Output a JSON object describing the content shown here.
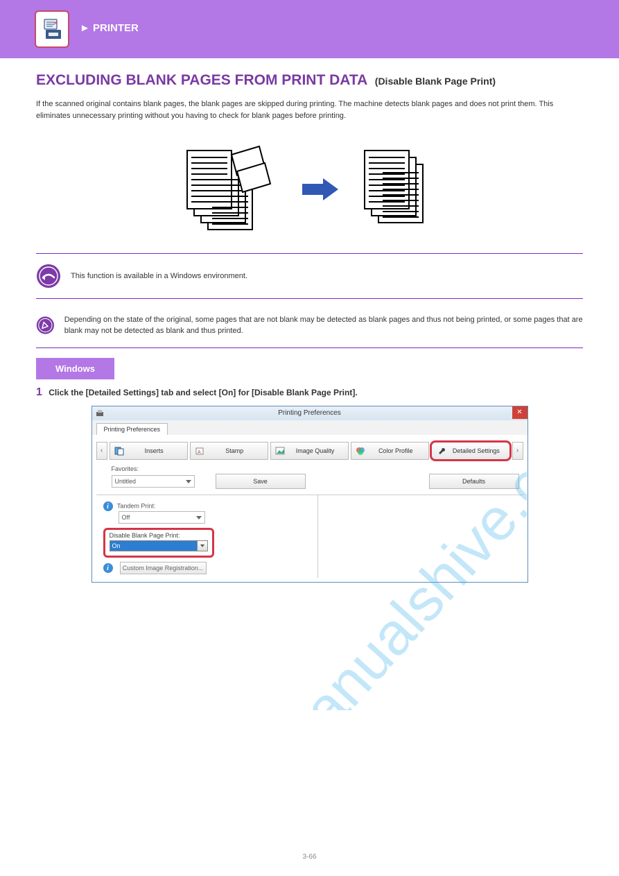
{
  "banner": {
    "label": "PRINTER"
  },
  "page": {
    "title_main": "EXCLUDING BLANK PAGES FROM PRINT DATA",
    "title_suffix": "(Disable Blank Page Print)",
    "intro": "If the scanned original contains blank pages, the blank pages are skipped during printing. The machine detects blank pages and does not print them. This eliminates unnecessary printing without you having to check for blank pages before printing.",
    "page_number": "3-66"
  },
  "notes": {
    "note1": "This function is available in a Windows environment.",
    "note2": "Depending on the state of the original, some pages that are not blank may be detected as blank pages and thus not being printed, or some pages that are blank may not be detected as blank and thus printed."
  },
  "env": {
    "label": "Windows"
  },
  "step": {
    "number": "1",
    "text": "Click the [Detailed Settings] tab and select [On] for [Disable Blank Page Print]."
  },
  "dialog": {
    "title": "Printing Preferences",
    "tab_label": "Printing Preferences",
    "tabs": {
      "inserts": "Inserts",
      "stamp": "Stamp",
      "image_quality": "Image Quality",
      "color_profile": "Color Profile",
      "detailed_settings": "Detailed Settings"
    },
    "favorites_label": "Favorites:",
    "favorites_value": "Untitled",
    "save": "Save",
    "defaults": "Defaults",
    "tandem_label": "Tandem Print:",
    "tandem_value": "Off",
    "disable_label": "Disable Blank Page Print:",
    "disable_value": "On",
    "custom_reg": "Custom Image Registration..."
  },
  "watermark": "manualshive.com"
}
